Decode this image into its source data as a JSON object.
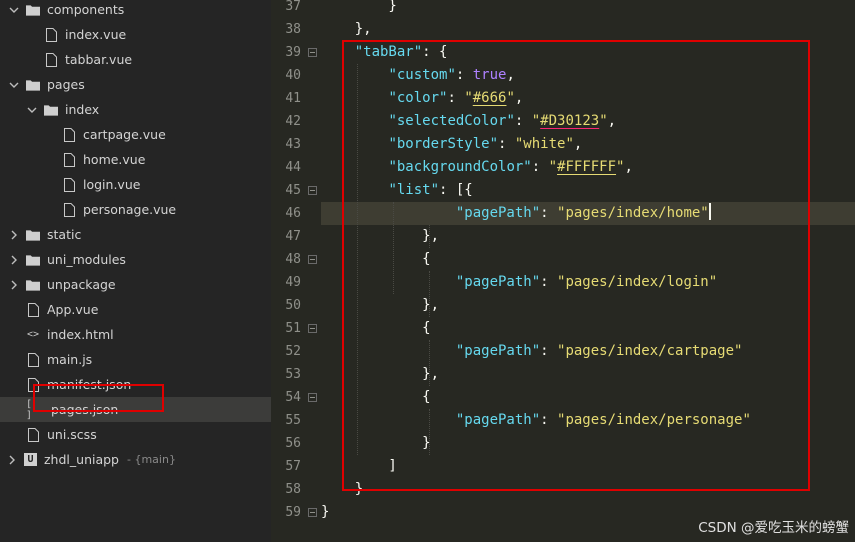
{
  "sidebar": {
    "items": [
      {
        "label": "components",
        "type": "folder",
        "expanded": true,
        "indent": 1
      },
      {
        "label": "index.vue",
        "type": "vue",
        "indent": 3
      },
      {
        "label": "tabbar.vue",
        "type": "vue",
        "indent": 3
      },
      {
        "label": "pages",
        "type": "folder",
        "expanded": true,
        "indent": 1
      },
      {
        "label": "index",
        "type": "folder",
        "expanded": true,
        "indent": 2
      },
      {
        "label": "cartpage.vue",
        "type": "vue",
        "indent": 4
      },
      {
        "label": "home.vue",
        "type": "vue",
        "indent": 4
      },
      {
        "label": "login.vue",
        "type": "vue",
        "indent": 4
      },
      {
        "label": "personage.vue",
        "type": "vue",
        "indent": 4
      },
      {
        "label": "static",
        "type": "folder",
        "expanded": false,
        "indent": 1
      },
      {
        "label": "uni_modules",
        "type": "folder",
        "expanded": false,
        "indent": 1
      },
      {
        "label": "unpackage",
        "type": "folder",
        "expanded": false,
        "indent": 1
      },
      {
        "label": "App.vue",
        "type": "vue",
        "indent": 2
      },
      {
        "label": "index.html",
        "type": "html",
        "indent": 2
      },
      {
        "label": "main.js",
        "type": "js",
        "indent": 2
      },
      {
        "label": "manifest.json",
        "type": "manifest",
        "indent": 2
      },
      {
        "label": "pages.json",
        "type": "json",
        "indent": 2,
        "selected": true
      },
      {
        "label": "uni.scss",
        "type": "scss",
        "indent": 2
      }
    ],
    "project": {
      "label": "zhdl_uniapp",
      "branch": "- {main}"
    }
  },
  "editor": {
    "lines": [
      {
        "n": "37",
        "code": [
          {
            "t": "        }",
            "c": "p"
          }
        ]
      },
      {
        "n": "38",
        "code": [
          {
            "t": "    },",
            "c": "p"
          }
        ]
      },
      {
        "n": "39",
        "fold": true,
        "code": [
          {
            "t": "    ",
            "c": "p"
          },
          {
            "t": "\"tabBar\"",
            "c": "k"
          },
          {
            "t": ": {",
            "c": "p"
          }
        ]
      },
      {
        "n": "40",
        "code": [
          {
            "t": "        ",
            "c": "p"
          },
          {
            "t": "\"custom\"",
            "c": "k"
          },
          {
            "t": ": ",
            "c": "p"
          },
          {
            "t": "true",
            "c": "kw"
          },
          {
            "t": ",",
            "c": "p"
          }
        ]
      },
      {
        "n": "41",
        "code": [
          {
            "t": "        ",
            "c": "p"
          },
          {
            "t": "\"color\"",
            "c": "k"
          },
          {
            "t": ": ",
            "c": "p"
          },
          {
            "t": "\"",
            "c": "s"
          },
          {
            "t": "#666",
            "c": "s underline-y"
          },
          {
            "t": "\"",
            "c": "s"
          },
          {
            "t": ",",
            "c": "p"
          }
        ]
      },
      {
        "n": "42",
        "code": [
          {
            "t": "        ",
            "c": "p"
          },
          {
            "t": "\"selectedColor\"",
            "c": "k"
          },
          {
            "t": ": ",
            "c": "p"
          },
          {
            "t": "\"",
            "c": "s"
          },
          {
            "t": "#D30123",
            "c": "s underline"
          },
          {
            "t": "\"",
            "c": "s"
          },
          {
            "t": ",",
            "c": "p"
          }
        ]
      },
      {
        "n": "43",
        "code": [
          {
            "t": "        ",
            "c": "p"
          },
          {
            "t": "\"borderStyle\"",
            "c": "k"
          },
          {
            "t": ": ",
            "c": "p"
          },
          {
            "t": "\"white\"",
            "c": "s"
          },
          {
            "t": ",",
            "c": "p"
          }
        ]
      },
      {
        "n": "44",
        "code": [
          {
            "t": "        ",
            "c": "p"
          },
          {
            "t": "\"backgroundColor\"",
            "c": "k"
          },
          {
            "t": ": ",
            "c": "p"
          },
          {
            "t": "\"",
            "c": "s"
          },
          {
            "t": "#FFFFFF",
            "c": "s underline-y"
          },
          {
            "t": "\"",
            "c": "s"
          },
          {
            "t": ",",
            "c": "p"
          }
        ]
      },
      {
        "n": "45",
        "fold": true,
        "code": [
          {
            "t": "        ",
            "c": "p"
          },
          {
            "t": "\"list\"",
            "c": "k"
          },
          {
            "t": ": [{",
            "c": "p"
          }
        ]
      },
      {
        "n": "46",
        "current": true,
        "cursor": true,
        "code": [
          {
            "t": "                ",
            "c": "p"
          },
          {
            "t": "\"pagePath\"",
            "c": "k"
          },
          {
            "t": ": ",
            "c": "p"
          },
          {
            "t": "\"pages/index/home\"",
            "c": "s"
          }
        ]
      },
      {
        "n": "47",
        "code": [
          {
            "t": "            },",
            "c": "p"
          }
        ]
      },
      {
        "n": "48",
        "fold": true,
        "code": [
          {
            "t": "            {",
            "c": "p"
          }
        ]
      },
      {
        "n": "49",
        "code": [
          {
            "t": "                ",
            "c": "p"
          },
          {
            "t": "\"pagePath\"",
            "c": "k"
          },
          {
            "t": ": ",
            "c": "p"
          },
          {
            "t": "\"pages/index/login\"",
            "c": "s"
          }
        ]
      },
      {
        "n": "50",
        "code": [
          {
            "t": "            },",
            "c": "p"
          }
        ]
      },
      {
        "n": "51",
        "fold": true,
        "code": [
          {
            "t": "            {",
            "c": "p"
          }
        ]
      },
      {
        "n": "52",
        "code": [
          {
            "t": "                ",
            "c": "p"
          },
          {
            "t": "\"pagePath\"",
            "c": "k"
          },
          {
            "t": ": ",
            "c": "p"
          },
          {
            "t": "\"pages/index/cartpage\"",
            "c": "s"
          }
        ]
      },
      {
        "n": "53",
        "code": [
          {
            "t": "            },",
            "c": "p"
          }
        ]
      },
      {
        "n": "54",
        "fold": true,
        "code": [
          {
            "t": "            {",
            "c": "p"
          }
        ]
      },
      {
        "n": "55",
        "code": [
          {
            "t": "                ",
            "c": "p"
          },
          {
            "t": "\"pagePath\"",
            "c": "k"
          },
          {
            "t": ": ",
            "c": "p"
          },
          {
            "t": "\"pages/index/personage\"",
            "c": "s"
          }
        ]
      },
      {
        "n": "56",
        "code": [
          {
            "t": "            }",
            "c": "p"
          }
        ]
      },
      {
        "n": "57",
        "code": [
          {
            "t": "        ]",
            "c": "p"
          }
        ]
      },
      {
        "n": "58",
        "code": [
          {
            "t": "    }",
            "c": "p"
          }
        ]
      },
      {
        "n": "59",
        "fold": true,
        "code": [
          {
            "t": "}",
            "c": "p"
          }
        ]
      }
    ]
  },
  "watermark": "CSDN @爱吃玉米的螃蟹",
  "colors": {
    "highlight_box": "#e00000",
    "editor_bg": "#272822",
    "sidebar_bg": "#252525"
  }
}
